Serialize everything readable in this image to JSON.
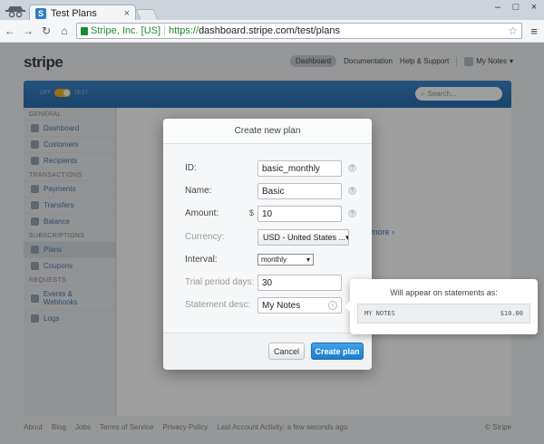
{
  "browser": {
    "tab_title": "Test Plans",
    "tab_favicon": "S",
    "ssl_label": "Stripe, Inc. [US]",
    "url_scheme": "https://",
    "url_rest": "dashboard.stripe.com/test/plans"
  },
  "header": {
    "logo": "stripe",
    "nav": {
      "dashboard": "Dashboard",
      "documentation": "Documentation",
      "help": "Help & Support",
      "account": "My Notes"
    }
  },
  "bluebar": {
    "toggle_off": "OFF",
    "toggle_on": "TEST",
    "search_placeholder": "Search..."
  },
  "sidebar": {
    "general": "GENERAL",
    "dashboard": "Dashboard",
    "customers": "Customers",
    "recipients": "Recipients",
    "transactions": "TRANSACTIONS",
    "payments": "Payments",
    "transfers": "Transfers",
    "balance": "Balance",
    "subscriptions": "SUBSCRIPTIONS",
    "plans": "Plans",
    "coupons": "Coupons",
    "requests": "REQUESTS",
    "events": "Events & Webhooks",
    "logs": "Logs"
  },
  "main": {
    "learn_more": "more ›"
  },
  "footer": {
    "about": "About",
    "blog": "Blog",
    "jobs": "Jobs",
    "terms": "Terms of Service",
    "privacy": "Privacy Policy",
    "last_activity": "Last Account Activity: a few seconds ago",
    "copyright": "© Stripe"
  },
  "modal": {
    "title": "Create new plan",
    "id_label": "ID:",
    "id_value": "basic_monthly",
    "name_label": "Name:",
    "name_value": "Basic",
    "amount_label": "Amount:",
    "amount_prefix": "$",
    "amount_value": "10",
    "currency_label": "Currency:",
    "currency_value": "USD - United States ...",
    "interval_label": "Interval:",
    "interval_value": "monthly",
    "trial_label": "Trial period days:",
    "trial_value": "30",
    "statement_label": "Statement desc:",
    "statement_value": "My Notes",
    "cancel": "Cancel",
    "create": "Create plan",
    "help_glyph": "?",
    "info_glyph": "i"
  },
  "tooltip": {
    "title": "Will appear on statements as:",
    "statement_text": "MY NOTES",
    "statement_amount": "$10.00"
  },
  "colors": {
    "accent_blue": "#2a7ccf",
    "ssl_green": "#1c8a2e",
    "toggle_yellow": "#f0b428"
  }
}
